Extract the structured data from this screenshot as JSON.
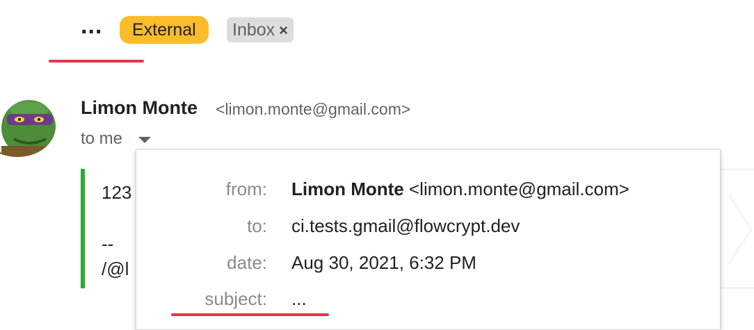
{
  "header": {
    "subject": "...",
    "labels": {
      "external": "External",
      "inbox": "Inbox",
      "inbox_remove": "×"
    }
  },
  "message": {
    "sender_name": "Limon Monte",
    "sender_email": "<limon.monte@gmail.com>",
    "to_me": "to me",
    "body_lines": [
      "123",
      "--",
      "/@l"
    ]
  },
  "details_popup": {
    "from_label": "from:",
    "from_name": "Limon Monte",
    "from_email": "<limon.monte@gmail.com>",
    "to_label": "to:",
    "to_value": "ci.tests.gmail@flowcrypt.dev",
    "date_label": "date:",
    "date_value": "Aug 30, 2021, 6:32 PM",
    "subject_label": "subject:",
    "subject_value": "..."
  },
  "colors": {
    "external_chip": "#fbbc2c",
    "inbox_chip": "#dddddd",
    "quote_bar": "#2ea836",
    "highlight_underline": "#e8344c"
  }
}
